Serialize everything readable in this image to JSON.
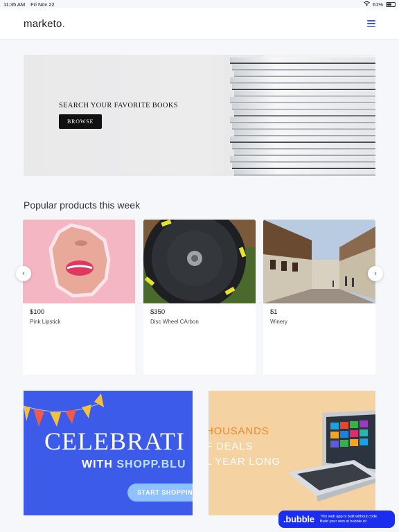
{
  "status_bar": {
    "time": "11:35 AM",
    "date": "Fri Nov 22",
    "battery": "61%",
    "battery_level": 0.61
  },
  "navbar": {
    "logo": "marketo",
    "logo_dot": "."
  },
  "hero": {
    "title": "SEARCH YOUR FAVORITE BOOKS",
    "button": "BROWSE"
  },
  "section": {
    "title": "Popular products this week"
  },
  "products": [
    {
      "price": "$100",
      "name": "Pink Lipstick"
    },
    {
      "price": "$350",
      "name": "Disc Wheel CArbon"
    },
    {
      "price": "$1",
      "name": "Winery"
    }
  ],
  "carousel": {
    "prev_icon": "‹",
    "next_icon": "›"
  },
  "promo_left": {
    "line1": "CELEBRATI",
    "with": "WITH ",
    "brand": "SHOPP.BLU",
    "button": "START SHOPPING"
  },
  "promo_right": {
    "line1": "HOUSANDS",
    "line2": "F DEALS",
    "line3": "L YEAR LONG"
  },
  "bubble": {
    "logo": ".bubble",
    "line1": "This web app is built without code.",
    "line2": "Build your own at bubble.io!"
  },
  "colors": {
    "accent": "#3b57e6",
    "promo_blue": "#3c5be8",
    "promo_peach": "#f4d2a2",
    "bubble_blue": "#1b2ef0"
  }
}
